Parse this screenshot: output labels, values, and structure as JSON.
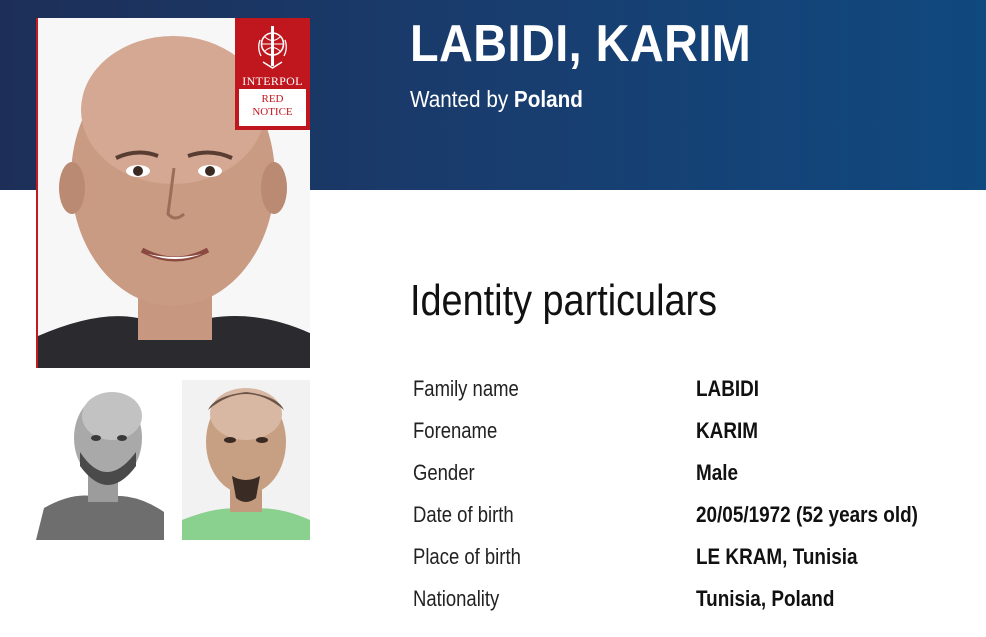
{
  "header": {
    "name": "LABIDI, KARIM",
    "wanted_prefix": "Wanted by",
    "wanted_country": "Poland"
  },
  "badge": {
    "organization": "INTERPOL",
    "notice_line1": "RED",
    "notice_line2": "NOTICE"
  },
  "section": {
    "title": "Identity particulars"
  },
  "particulars": [
    {
      "label": "Family name",
      "value": "LABIDI"
    },
    {
      "label": "Forename",
      "value": "KARIM"
    },
    {
      "label": "Gender",
      "value": "Male"
    },
    {
      "label": "Date of birth",
      "value": "20/05/1972 (52 years old)"
    },
    {
      "label": "Place of birth",
      "value": "LE KRAM, Tunisia"
    },
    {
      "label": "Nationality",
      "value": "Tunisia, Poland"
    }
  ],
  "colors": {
    "banner": "#183e70",
    "notice_red": "#c0171e"
  },
  "icons": [
    "interpol-emblem-icon"
  ]
}
